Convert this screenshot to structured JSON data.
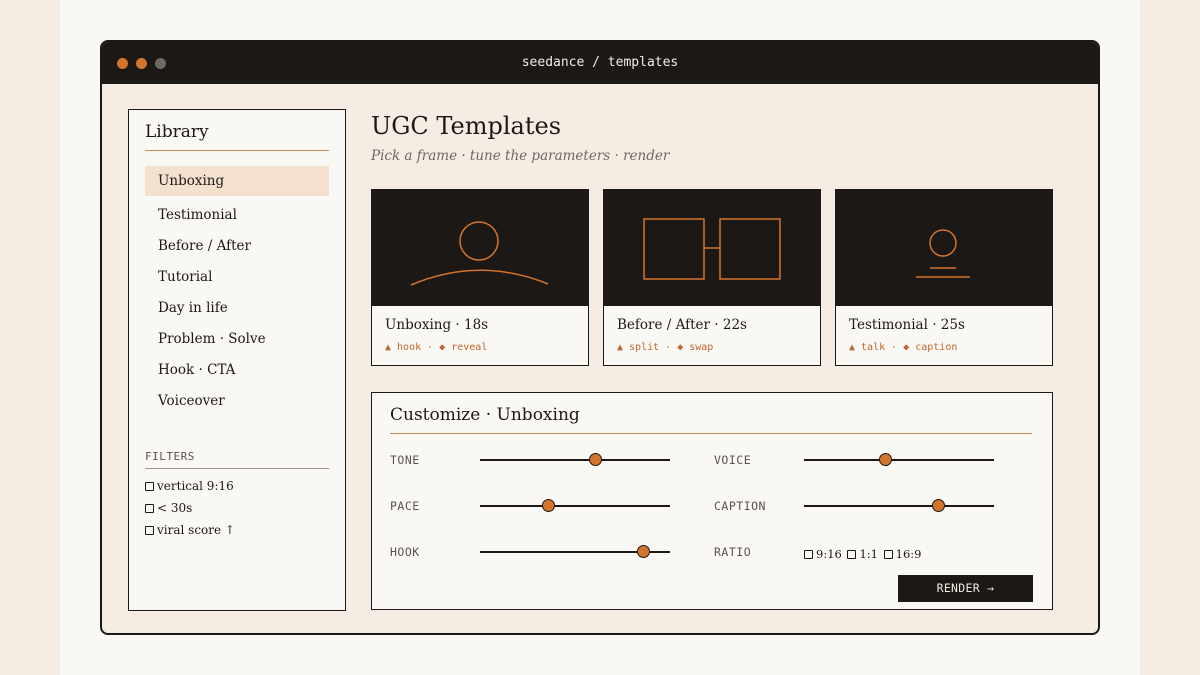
{
  "window": {
    "title": "seedance / templates"
  },
  "sidebar": {
    "heading": "Library",
    "items": [
      {
        "label": "Unboxing",
        "active": true
      },
      {
        "label": "Testimonial"
      },
      {
        "label": "Before / After"
      },
      {
        "label": "Tutorial"
      },
      {
        "label": "Day in life"
      },
      {
        "label": "Problem · Solve"
      },
      {
        "label": "Hook · CTA"
      },
      {
        "label": "Voiceover"
      }
    ],
    "filters_heading": "FILTERS",
    "filters": [
      {
        "label": "vertical 9:16",
        "checked": false
      },
      {
        "label": "< 30s",
        "checked": false
      },
      {
        "label": "viral score ↑",
        "checked": false
      }
    ]
  },
  "main": {
    "title": "UGC Templates",
    "subtitle": "Pick a frame · tune the parameters · render"
  },
  "cards": [
    {
      "title": "Unboxing · 18s",
      "tags": "▲ hook · ◆ reveal",
      "icon": "person-icon"
    },
    {
      "title": "Before / After · 22s",
      "tags": "▲ split · ◆ swap",
      "icon": "split-frames-icon"
    },
    {
      "title": "Testimonial · 25s",
      "tags": "▲ talk · ◆ caption",
      "icon": "speaker-icon"
    }
  ],
  "customize": {
    "title": "Customize · Unboxing",
    "params": [
      {
        "label": "TONE",
        "value": 0.61
      },
      {
        "label": "VOICE",
        "value": 0.43
      },
      {
        "label": "PACE",
        "value": 0.36
      },
      {
        "label": "CAPTION",
        "value": 0.71
      },
      {
        "label": "HOOK",
        "value": 0.86
      }
    ],
    "ratio": {
      "label": "RATIO",
      "options": [
        "9:16",
        "1:1",
        "16:9"
      ]
    },
    "render_label": "RENDER →"
  },
  "colors": {
    "accent": "#d2742c",
    "dark": "#1c1815",
    "active_bg": "#f3e1cd",
    "panel_bg": "#faf8f4",
    "window_bg": "#f5ede4"
  }
}
